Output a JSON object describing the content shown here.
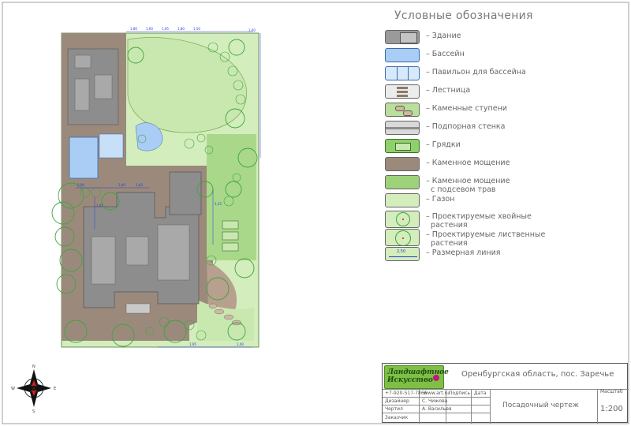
{
  "legend": {
    "title": "Условные обозначения",
    "items": [
      {
        "key": "building",
        "label": "– Здание"
      },
      {
        "key": "pool",
        "label": "– Бассейн"
      },
      {
        "key": "pavilion",
        "label": "– Павильон для бассейна"
      },
      {
        "key": "stairs",
        "label": "– Лестница"
      },
      {
        "key": "stone-steps",
        "label": "– Каменные ступени"
      },
      {
        "key": "retaining-wall",
        "label": "– Подпорная стенка"
      },
      {
        "key": "beds",
        "label": "– Грядки"
      },
      {
        "key": "stone-paving",
        "label": "– Каменное мощение"
      },
      {
        "key": "paving-grass",
        "label": "– Каменное мощение\n  с подсевом трав"
      },
      {
        "key": "lawn",
        "label": "– Газон"
      },
      {
        "key": "conifers",
        "label": "– Проектируемые хвойные\n  растения"
      },
      {
        "key": "deciduous",
        "label": "– Проектируемые лиственные\n  растения"
      },
      {
        "key": "dimension",
        "label": "– Размерная линия"
      }
    ],
    "dimension_sample": "2,50"
  },
  "title_block": {
    "logo_line1": "Ландшафтное",
    "logo_line2": "Искусство",
    "address": "Оренбургская область, пос. Заречье",
    "contacts": "+7-920-517-7866",
    "site": "www.art.ru",
    "col_sign": "Подпись",
    "col_date": "Дата",
    "designer_label": "Дизайнер",
    "designer_name": "С. Чижова",
    "drafter_label": "Чертил",
    "drafter_name": "А. Васильев",
    "customer_label": "Заказчик",
    "drawing_title": "Посадочный чертеж",
    "scale_label": "Масштаб",
    "scale_value": "1:200"
  },
  "plan_labels": {
    "dims": [
      "1,80",
      "1,60",
      "1,95",
      "1,80",
      "1,50",
      "2,00",
      "1,45",
      "1,80",
      "1,60",
      "1,25",
      "1,60",
      "1,95",
      "1,00"
    ]
  },
  "colors": {
    "paving": "#9b8a7c",
    "lawn": "#c9e8b0",
    "paving_grass": "#9ed27a",
    "building": "#8d8d8d",
    "pool": "#a9cdf5",
    "tree_stroke": "#3fa33f",
    "dimension": "#2b3dd6"
  }
}
